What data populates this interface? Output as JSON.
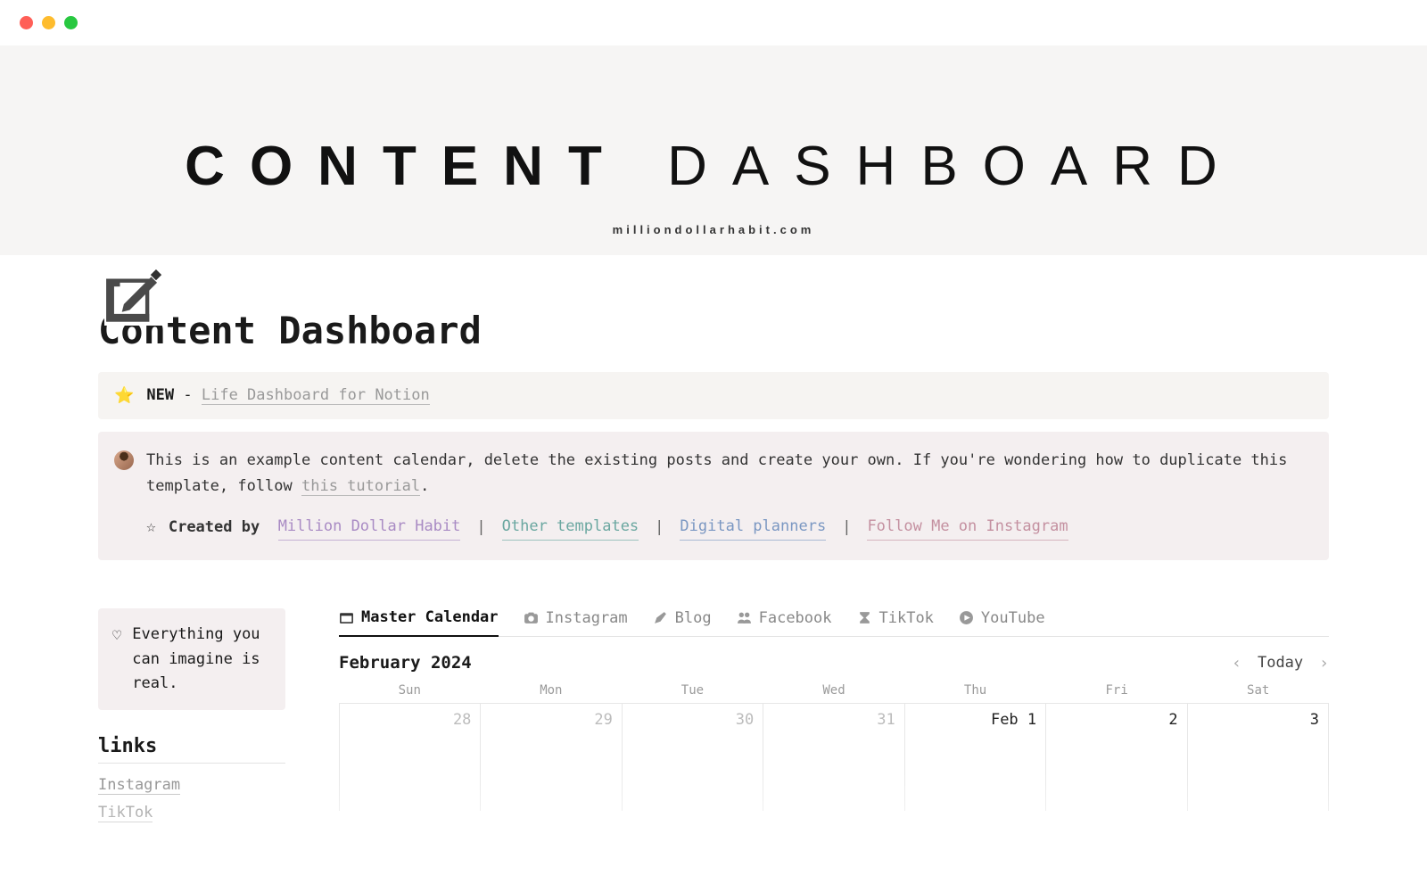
{
  "cover": {
    "title_bold": "CONTENT",
    "title_light": "DASHBOARD",
    "subtitle": "milliondollarhabit.com"
  },
  "page": {
    "title": "Content Dashboard"
  },
  "callout_new": {
    "badge": "NEW",
    "dash": " - ",
    "link_text": "Life Dashboard for Notion"
  },
  "callout_info": {
    "text_a": "This is an example content calendar, delete the existing posts and create your own. If you're wondering how to duplicate this template, follow ",
    "tutorial_link": "this tutorial",
    "text_b": ".",
    "created_by_label": "Created by",
    "creator": "Million Dollar Habit",
    "other_templates": "Other templates",
    "digital_planners": "Digital planners",
    "follow": "Follow Me on Instagram"
  },
  "sidebar": {
    "quote": "Everything you can imagine is real.",
    "links_heading": "links",
    "links": [
      "Instagram",
      "TikTok"
    ]
  },
  "tabs": [
    {
      "label": "Master Calendar",
      "icon": "calendar"
    },
    {
      "label": "Instagram",
      "icon": "camera"
    },
    {
      "label": "Blog",
      "icon": "pencil"
    },
    {
      "label": "Facebook",
      "icon": "people"
    },
    {
      "label": "TikTok",
      "icon": "hourglass"
    },
    {
      "label": "YouTube",
      "icon": "play"
    }
  ],
  "calendar": {
    "month_label": "February 2024",
    "today_label": "Today",
    "dow": [
      "Sun",
      "Mon",
      "Tue",
      "Wed",
      "Thu",
      "Fri",
      "Sat"
    ],
    "row1": [
      {
        "label": "28",
        "current": false
      },
      {
        "label": "29",
        "current": false
      },
      {
        "label": "30",
        "current": false
      },
      {
        "label": "31",
        "current": false
      },
      {
        "label": "Feb 1",
        "current": true
      },
      {
        "label": "2",
        "current": true
      },
      {
        "label": "3",
        "current": true
      }
    ]
  }
}
